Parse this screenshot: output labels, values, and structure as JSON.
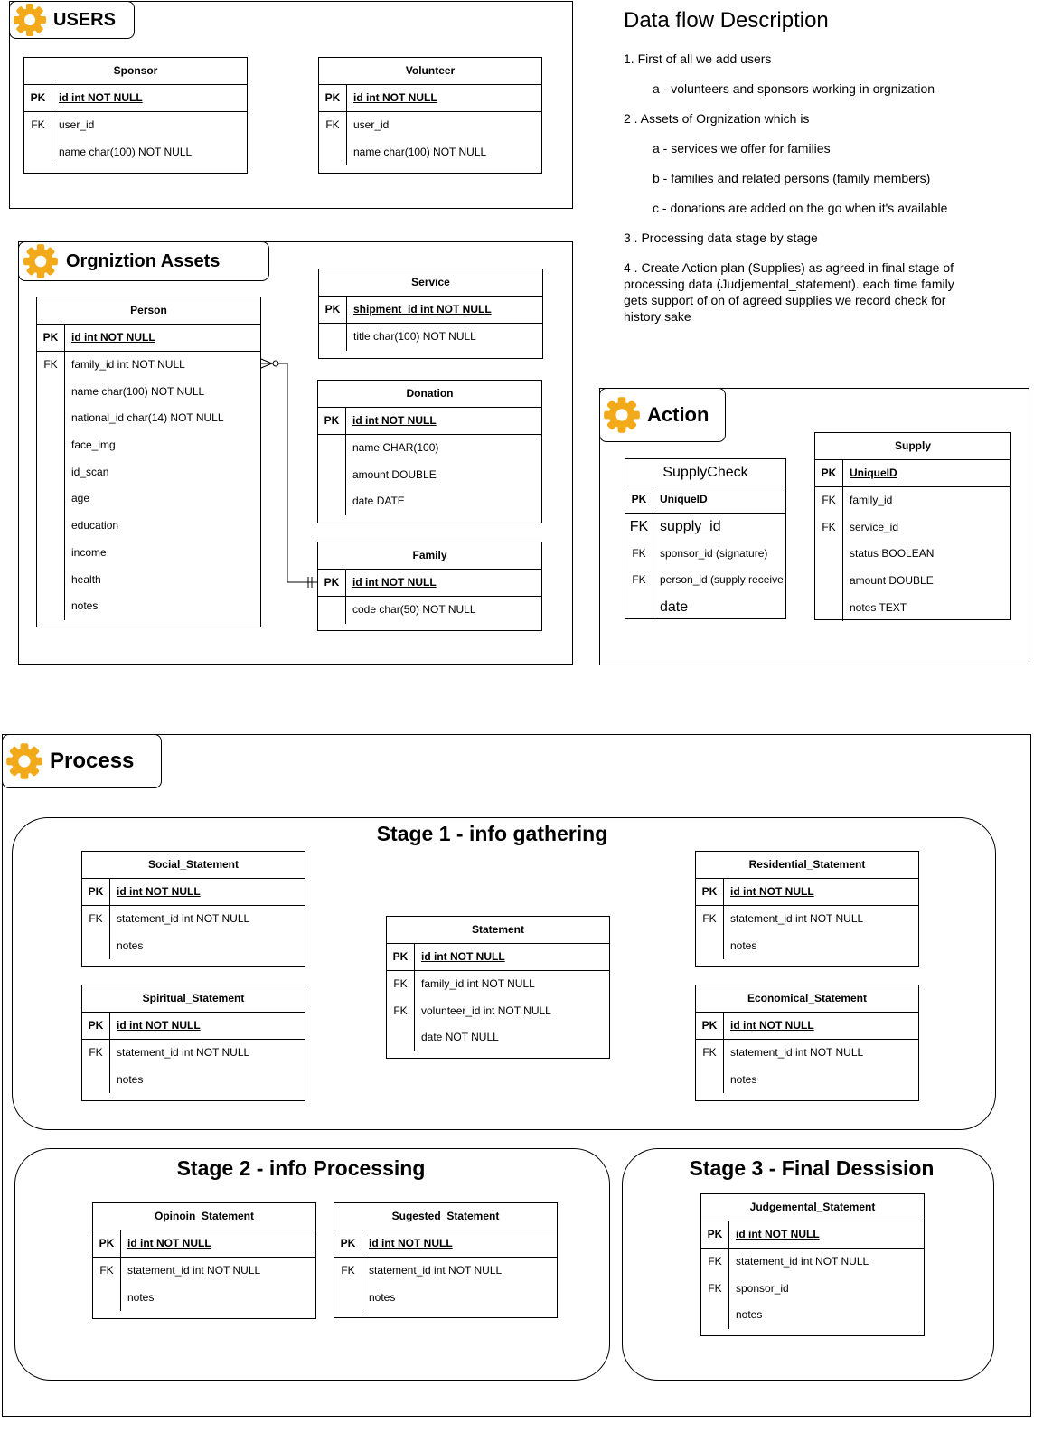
{
  "groups": {
    "users": "USERS",
    "assets": "Orgniztion Assets",
    "action": "Action",
    "process": "Process"
  },
  "stages": {
    "s1": "Stage 1 - info gathering",
    "s2": "Stage 2 - info Processing",
    "s3": "Stage 3 - Final Dessision"
  },
  "description": {
    "title": "Data flow Description",
    "items": [
      "1. First  of all we add users",
      "a - volunteers and sponsors working in orgnization",
      "2 . Assets of  Orgnization which is",
      "a -  services we offer for families",
      "b - families and related persons (family members)",
      "c - donations are added on the go when it's available",
      "3 . Processing data  stage by stage",
      "4 . Create Action plan (Supplies) as agreed in final stage of processing data (Judjemental_statement). each time family gets support of on of agreed supplies we record check for history sake"
    ]
  },
  "tables": {
    "sponsor": {
      "name": "Sponsor",
      "pk": [
        "PK",
        "id int NOT NULL"
      ],
      "rows": [
        [
          "FK",
          "user_id"
        ],
        [
          "",
          "name char(100) NOT NULL"
        ]
      ]
    },
    "volunteer": {
      "name": "Volunteer",
      "pk": [
        "PK",
        "id int NOT NULL"
      ],
      "rows": [
        [
          "FK",
          "user_id"
        ],
        [
          "",
          "name char(100) NOT NULL"
        ]
      ]
    },
    "person": {
      "name": "Person",
      "pk": [
        "PK",
        "id int NOT NULL"
      ],
      "rows": [
        [
          "FK",
          "family_id int NOT NULL"
        ],
        [
          "",
          "name char(100) NOT NULL"
        ],
        [
          "",
          "national_id char(14) NOT NULL"
        ],
        [
          "",
          "face_img"
        ],
        [
          "",
          "id_scan"
        ],
        [
          "",
          "age"
        ],
        [
          "",
          "education"
        ],
        [
          "",
          "income"
        ],
        [
          "",
          "health"
        ],
        [
          "",
          "notes"
        ]
      ]
    },
    "service": {
      "name": "Service",
      "pk": [
        "PK",
        "shipment_id int NOT NULL"
      ],
      "rows": [
        [
          "",
          "title char(100)  NOT NULL"
        ]
      ]
    },
    "donation": {
      "name": "Donation",
      "pk": [
        "PK",
        "id int NOT NULL"
      ],
      "rows": [
        [
          "",
          "name CHAR(100)"
        ],
        [
          "",
          "amount   DOUBLE"
        ],
        [
          "",
          "date    DATE"
        ]
      ]
    },
    "family": {
      "name": "Family",
      "pk": [
        "PK",
        "id int NOT NULL"
      ],
      "rows": [
        [
          "",
          "code char(50) NOT NULL"
        ]
      ]
    },
    "supplycheck": {
      "name": "SupplyCheck",
      "pk": [
        "PK",
        "UniqueID"
      ],
      "rows": [
        [
          "FK",
          "supply_id"
        ],
        [
          "FK",
          "sponsor_id (signature)"
        ],
        [
          "FK",
          "person_id (supply receive"
        ],
        [
          "",
          "date"
        ]
      ]
    },
    "supply": {
      "name": "Supply",
      "pk": [
        "PK",
        "UniqueID"
      ],
      "rows": [
        [
          "FK",
          "family_id"
        ],
        [
          "FK",
          "service_id"
        ],
        [
          "",
          "status  BOOLEAN"
        ],
        [
          "",
          "amount   DOUBLE"
        ],
        [
          "",
          "notes    TEXT"
        ]
      ]
    },
    "social": {
      "name": "Social_Statement",
      "pk": [
        "PK",
        "id int NOT NULL"
      ],
      "rows": [
        [
          "FK",
          "statement_id int  NOT NULL"
        ],
        [
          "",
          "notes"
        ]
      ]
    },
    "spiritual": {
      "name": "Spiritual_Statement",
      "pk": [
        "PK",
        "id int NOT NULL"
      ],
      "rows": [
        [
          "FK",
          "statement_id int  NOT NULL"
        ],
        [
          "",
          "notes"
        ]
      ]
    },
    "statement": {
      "name": "Statement",
      "pk": [
        "PK",
        "id int NOT NULL"
      ],
      "rows": [
        [
          "FK",
          "family_id  int  NOT NULL"
        ],
        [
          "FK",
          "volunteer_id int NOT NULL"
        ],
        [
          "",
          "date NOT NULL"
        ]
      ]
    },
    "residential": {
      "name": "Residential_Statement",
      "pk": [
        "PK",
        "id int NOT NULL"
      ],
      "rows": [
        [
          "FK",
          "statement_id int  NOT NULL"
        ],
        [
          "",
          "notes"
        ]
      ]
    },
    "economical": {
      "name": "Economical_Statement",
      "pk": [
        "PK",
        "id int NOT NULL"
      ],
      "rows": [
        [
          "FK",
          "statement_id int  NOT NULL"
        ],
        [
          "",
          "notes"
        ]
      ]
    },
    "opinion": {
      "name": "Opinoin_Statement",
      "pk": [
        "PK",
        "id int NOT NULL"
      ],
      "rows": [
        [
          "FK",
          "statement_id int  NOT NULL"
        ],
        [
          "",
          "notes"
        ]
      ]
    },
    "sugested": {
      "name": "Sugested_Statement",
      "pk": [
        "PK",
        "id int NOT NULL"
      ],
      "rows": [
        [
          "FK",
          "statement_id int  NOT NULL"
        ],
        [
          "",
          "notes"
        ]
      ]
    },
    "judgemental": {
      "name": "Judgemental_Statement",
      "pk": [
        "PK",
        "id int NOT NULL"
      ],
      "rows": [
        [
          "FK",
          "statement_id int  NOT NULL"
        ],
        [
          "FK",
          "sponsor_id"
        ],
        [
          "",
          "notes"
        ]
      ]
    }
  },
  "colors": {
    "gear": "#f2a91a",
    "line": "#000000"
  }
}
